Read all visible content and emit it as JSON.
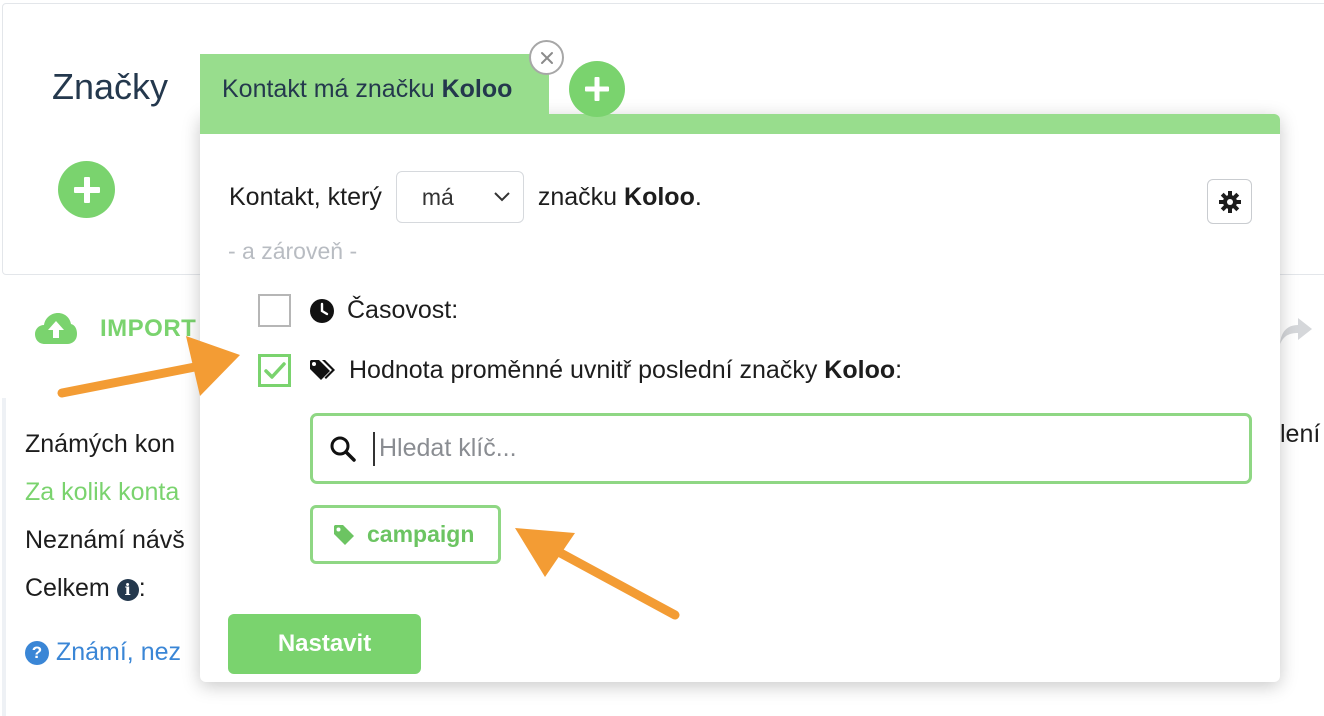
{
  "background": {
    "tags_title": "Značky",
    "import_label": "IMPORT",
    "stats": {
      "known_contacts": "Známých kon",
      "per_how_many": "Za kolik konta",
      "unknown_visitors": "Neznámí návš",
      "total": "Celkem",
      "total_suffix": ":",
      "info_glyph": "i",
      "help_link": "Známí, nez",
      "help_glyph": "?",
      "right_fragment": "lení"
    }
  },
  "filter": {
    "tab_prefix": "Kontakt má značku ",
    "tab_tag": "Koloo",
    "close_glyph": "×",
    "sentence_start": "Kontakt, který",
    "select_value": "má",
    "sentence_mid": "značku ",
    "sentence_tag": "Koloo",
    "sentence_end": ".",
    "and_label": "- a zároveň -",
    "options": [
      {
        "label": "Časovost:",
        "checked": false,
        "icon": "clock-icon"
      },
      {
        "label_prefix": "Hodnota proměnné uvnitř poslední značky ",
        "label_tag": "Koloo",
        "label_suffix": ":",
        "checked": true,
        "icon": "tags-icon"
      }
    ],
    "search_placeholder": "Hledat klíč...",
    "chip_label": "campaign",
    "submit_label": "Nastavit"
  },
  "colors": {
    "accent_green": "#7ad36e",
    "tab_green": "#98dd8d",
    "annotation_orange": "#f39c34",
    "link_blue": "#3a86d6",
    "heading_navy": "#24384d"
  }
}
